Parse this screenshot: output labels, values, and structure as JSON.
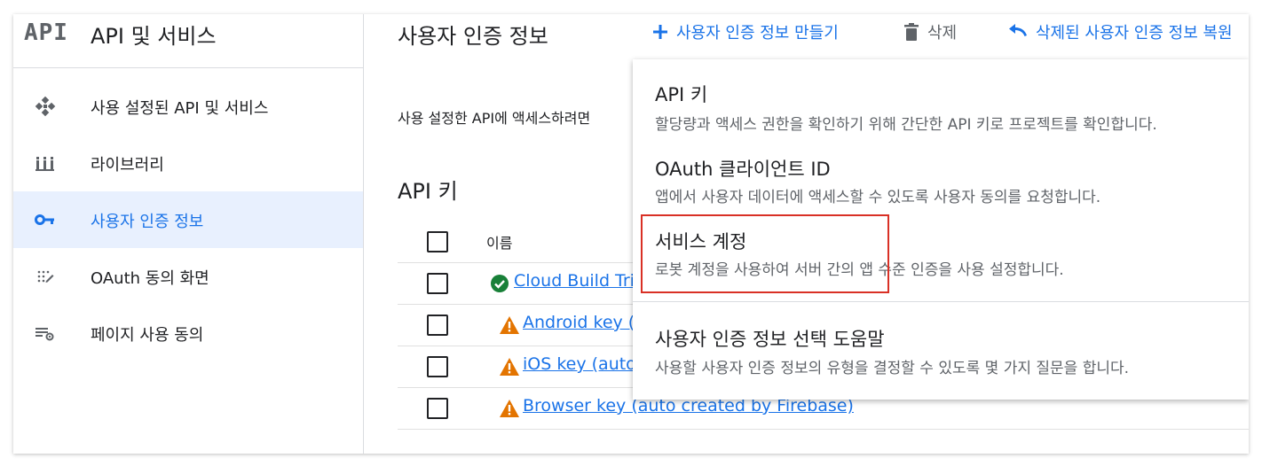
{
  "sidebar": {
    "logo": "API",
    "title": "API 및 서비스",
    "items": [
      {
        "label": "사용 설정된 API 및 서비스",
        "icon": "api-hub-icon",
        "active": false
      },
      {
        "label": "라이브러리",
        "icon": "library-icon",
        "active": false
      },
      {
        "label": "사용자 인증 정보",
        "icon": "key-icon",
        "active": true
      },
      {
        "label": "OAuth 동의 화면",
        "icon": "consent-screen-icon",
        "active": false
      },
      {
        "label": "페이지 사용 동의",
        "icon": "page-settings-icon",
        "active": false
      }
    ]
  },
  "header": {
    "title": "사용자 인증 정보",
    "create_label": "사용자 인증 정보 만들기",
    "delete_label": "삭제",
    "restore_label": "삭제된 사용자 인증 정보 복원"
  },
  "main": {
    "description": "사용 설정한 API에 액세스하려면",
    "section_title": "API 키",
    "table": {
      "header": {
        "name": "이름"
      },
      "rows": [
        {
          "name": "Cloud Build Tri",
          "status": "ok"
        },
        {
          "name": "Android key (a",
          "status": "warning"
        },
        {
          "name": "iOS key (auto",
          "status": "warning"
        },
        {
          "name": "Browser key (auto created by Firebase)",
          "status": "warning"
        }
      ]
    }
  },
  "menu": {
    "items": [
      {
        "title": "API 키",
        "desc": "할당량과 액세스 권한을 확인하기 위해 간단한 API 키로 프로젝트를 확인합니다."
      },
      {
        "title": "OAuth 클라이언트 ID",
        "desc": "앱에서 사용자 데이터에 액세스할 수 있도록 사용자 동의를 요청합니다."
      },
      {
        "title": "서비스 계정",
        "desc": "로봇 계정을 사용하여 서버 간의 앱 수준 인증을 사용 설정합니다."
      },
      {
        "title": "사용자 인증 정보 선택 도움말",
        "desc": "사용할 사용자 인증 정보의 유형을 결정할 수 있도록 몇 가지 질문을 합니다."
      }
    ]
  },
  "colors": {
    "accent": "#1a73e8",
    "active_bg": "#e8f0fe",
    "ok": "#188038",
    "warning": "#e37400",
    "highlight": "#d93025"
  }
}
